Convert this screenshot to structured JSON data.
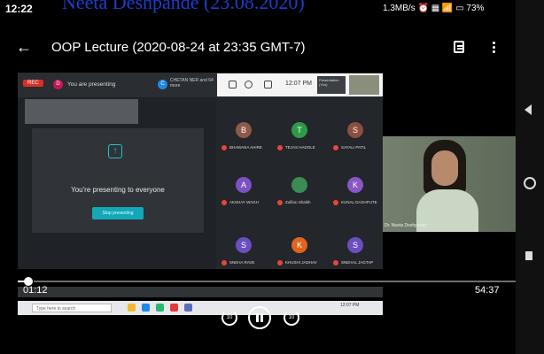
{
  "status_bar": {
    "time": "12:22",
    "network_speed": "1.3MB/s",
    "battery": "73%",
    "overlay_title": "Neeta Deshpande (23.08.2020)"
  },
  "header": {
    "back_label": "←",
    "title": "OOP Lecture (2020-08-24 at 23:35 GMT-7)"
  },
  "meeting": {
    "rec_label": "REC",
    "presenter_initial": "D",
    "presenting_label": "You are presenting",
    "participants_initial": "C",
    "participants_label": "CHETAN NER and 64 more",
    "clock": "12:07 PM",
    "presentation_chip": "Presentation (You)",
    "share_message": "You're presenting to everyone",
    "stop_button": "Stop presenting",
    "tiles": [
      {
        "initial": "B",
        "name": "BHAWANA AHIRE",
        "color": "#8d5a4a"
      },
      {
        "initial": "T",
        "name": "TEJAS HADOLE",
        "color": "#2e9a48"
      },
      {
        "initial": "S",
        "name": "SAYALI PATIL",
        "color": "#8a4f3f"
      },
      {
        "initial": "A",
        "name": "AKSHAY WAGH",
        "color": "#7b52c2"
      },
      {
        "initial": "",
        "name": "Zulfion Shaikh",
        "color": "#3b8b55"
      },
      {
        "initial": "K",
        "name": "KUNAL DASHPUTE",
        "color": "#8a55c6"
      },
      {
        "initial": "S",
        "name": "SNEHA RAVE",
        "color": "#6a4fc0"
      },
      {
        "initial": "K",
        "name": "KHUSHI JADHAV",
        "color": "#e0631e"
      },
      {
        "initial": "S",
        "name": "SNEHAL JAGTAP",
        "color": "#6a4fc0"
      }
    ],
    "camera_name": "Dr. Neeta Deshpande"
  },
  "taskbar": {
    "search_placeholder": "Type here to search",
    "clock": "12:07 PM"
  },
  "player": {
    "current_time": "01:12",
    "total_time": "54:37",
    "progress_fraction": 0.022,
    "rewind_seconds": "10",
    "forward_seconds": "10"
  }
}
